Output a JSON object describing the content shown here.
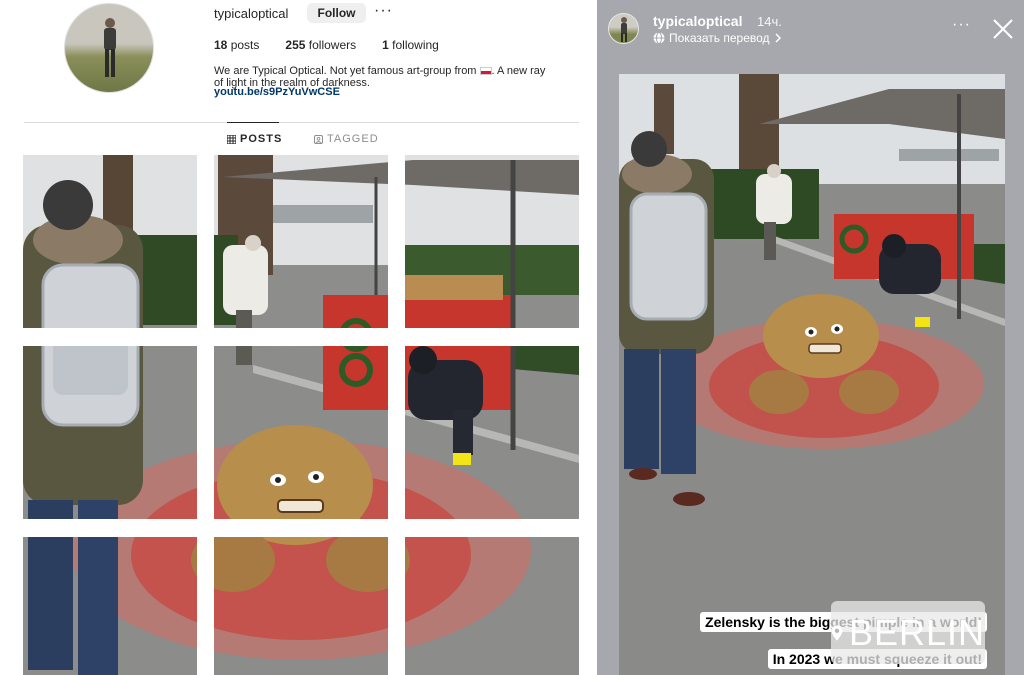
{
  "profile": {
    "username": "typicaloptical",
    "follow_label": "Follow",
    "more_label": "···",
    "stats": {
      "posts_count": "18",
      "posts_label": "posts",
      "followers_count": "255",
      "followers_label": "followers",
      "following_count": "1",
      "following_label": "following"
    },
    "bio_line1": "We are Typical Optical. Not yet famous art-group from",
    "bio_line1_end": ". A new ray",
    "bio_line2": "of light in the realm of darkness.",
    "bio_link": "youtu.be/s9PzYuVwCSE",
    "tabs": [
      {
        "label": "POSTS",
        "icon": "grid-icon",
        "active": true
      },
      {
        "label": "TAGGED",
        "icon": "tag-icon",
        "active": false
      }
    ],
    "grid_cells": 9
  },
  "story": {
    "username": "typicaloptical",
    "time": "14ч.",
    "translate_label": "Показать перевод",
    "more_label": "···",
    "caption_1": "Zelensky is the biggest pimple in a world!",
    "caption_2": "In 2023 we must squeeze it out!",
    "location": "BERLIN"
  },
  "colors": {
    "link": "#00376b",
    "story_bg": "#a7a8ae",
    "button_bg": "#efefef"
  }
}
